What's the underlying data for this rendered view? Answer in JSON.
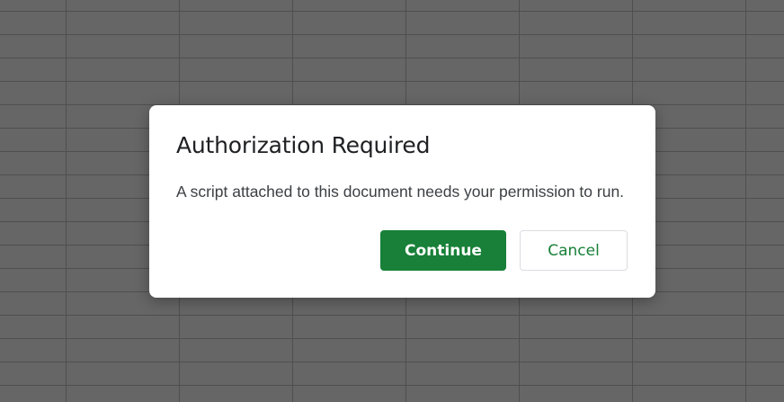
{
  "dialog": {
    "title": "Authorization Required",
    "message": "A script attached to this document needs your permission to run.",
    "continue_label": "Continue",
    "cancel_label": "Cancel"
  },
  "colors": {
    "primary_button": "#188038",
    "cancel_text": "#188038",
    "scrim": "rgba(0,0,0,0.6)",
    "grid_line": "#c6c6c6"
  }
}
